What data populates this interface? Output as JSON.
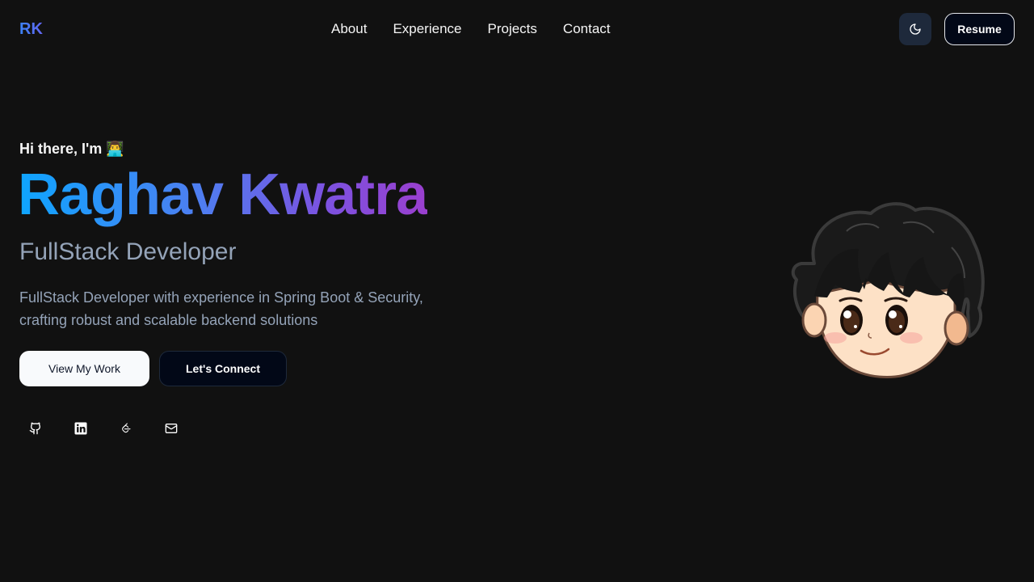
{
  "header": {
    "logo": "RK",
    "nav": [
      {
        "label": "About"
      },
      {
        "label": "Experience"
      },
      {
        "label": "Projects"
      },
      {
        "label": "Contact"
      }
    ],
    "theme_icon": "moon-icon",
    "resume_label": "Resume"
  },
  "hero": {
    "greeting": "Hi there, I'm 👨‍💻",
    "name": "Raghav Kwatra",
    "role": "FullStack Developer",
    "description": "FullStack Developer with experience in Spring Boot & Security, crafting robust and scalable backend solutions",
    "primary_cta": "View My Work",
    "secondary_cta": "Let's Connect",
    "socials": [
      {
        "icon": "github-icon"
      },
      {
        "icon": "linkedin-icon"
      },
      {
        "icon": "leetcode-icon"
      },
      {
        "icon": "mail-icon"
      }
    ],
    "avatar_icon": "avatar-illustration"
  },
  "colors": {
    "background": "#111111",
    "accent_blue": "#3b82f6",
    "accent_purple": "#9a3fce",
    "muted_text": "#94a3b8"
  }
}
